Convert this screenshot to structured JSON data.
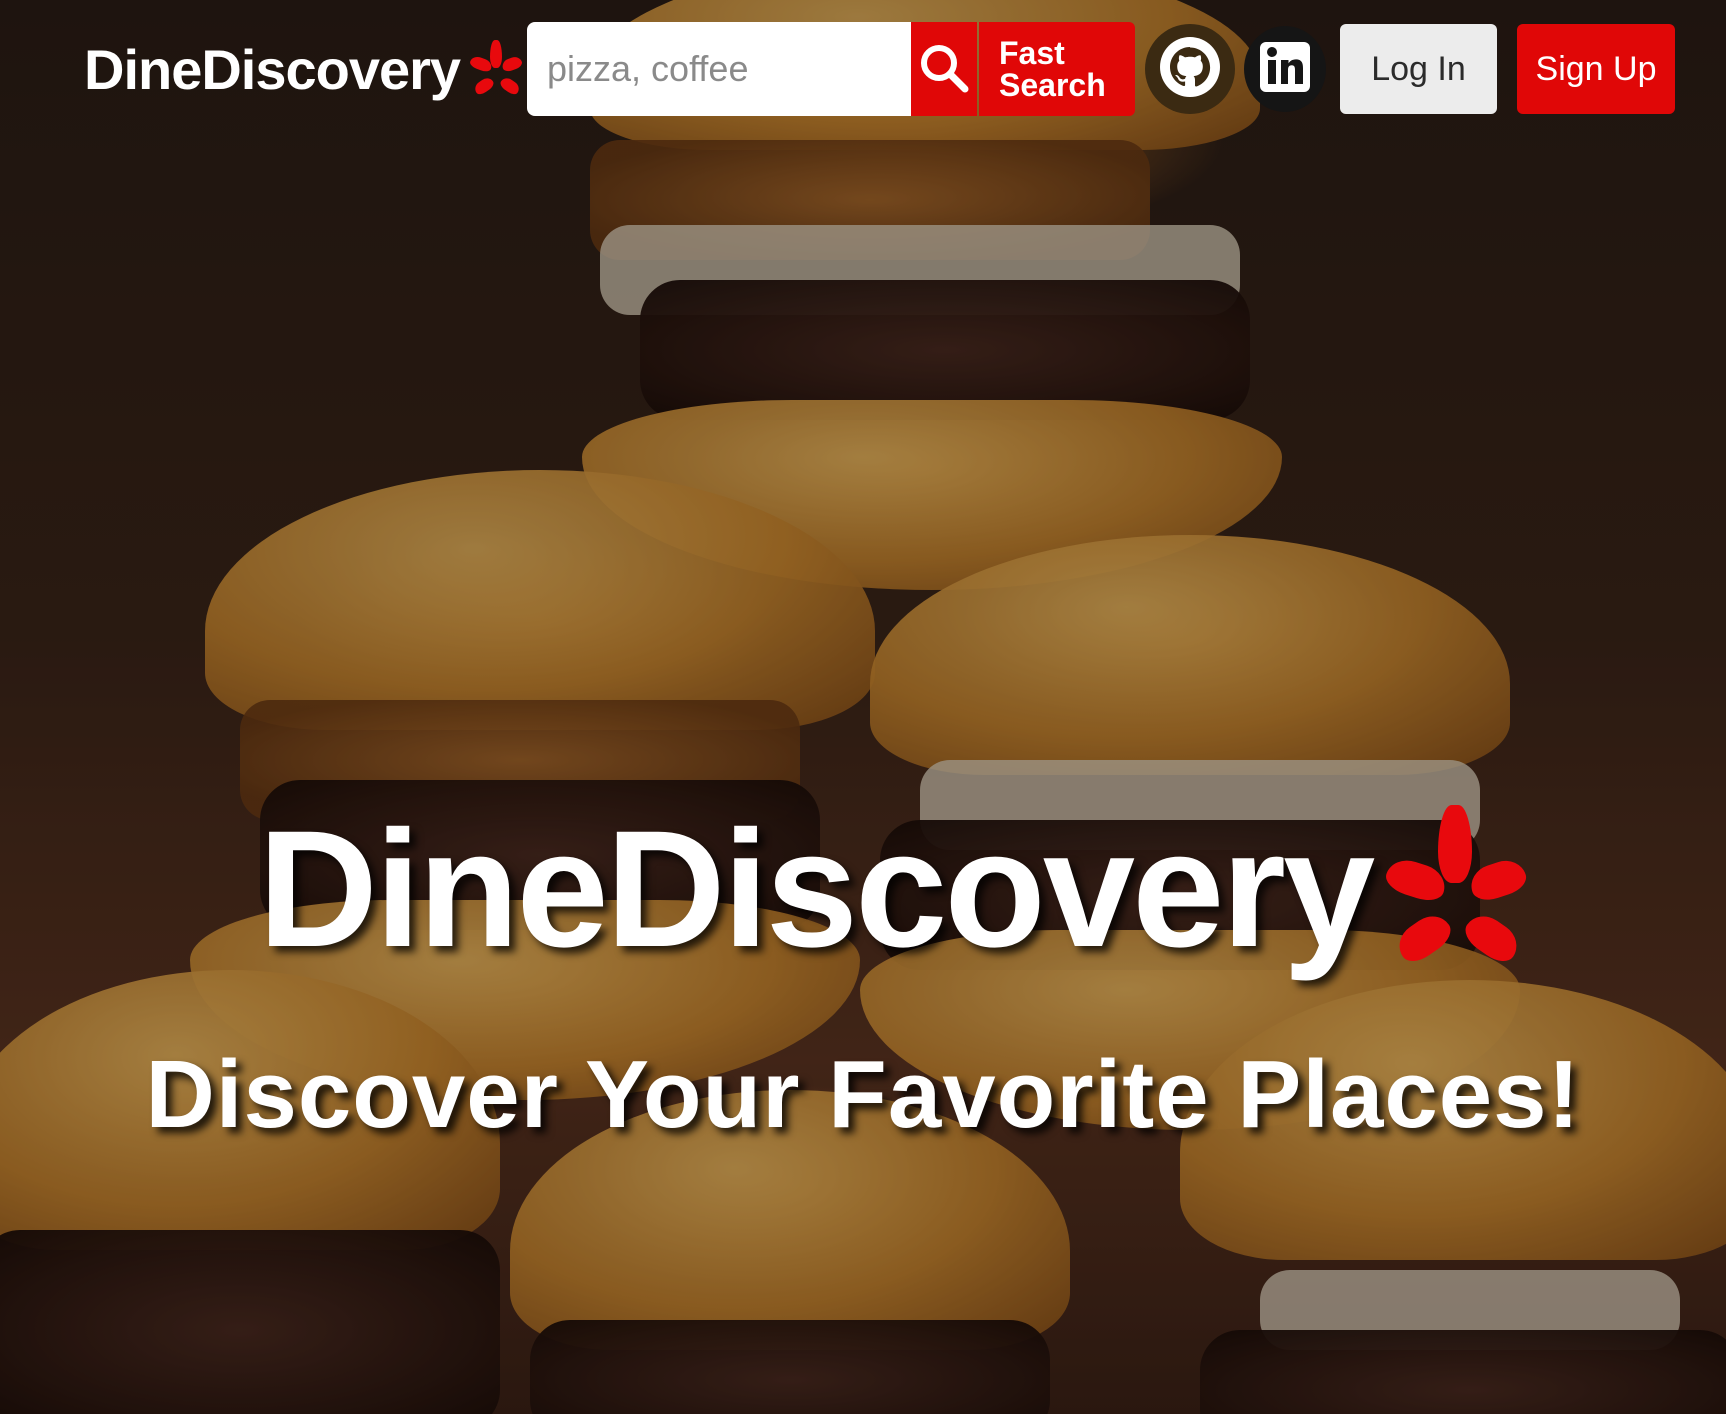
{
  "header": {
    "brand": "DineDiscovery",
    "search": {
      "placeholder": "pizza, coffee",
      "value": ""
    },
    "search_icon": "search-icon",
    "fast_search_label_line1": "Fast",
    "fast_search_label_line2": "Search",
    "social": [
      {
        "name": "GitHub",
        "icon": "github-icon"
      },
      {
        "name": "LinkedIn",
        "icon": "linkedin-icon"
      }
    ],
    "login_label": "Log In",
    "signup_label": "Sign Up"
  },
  "hero": {
    "title": "DineDiscovery",
    "subtitle": "Discover Your Favorite Places!",
    "background": "burgers-photo"
  },
  "colors": {
    "accent": "#e00707",
    "login_bg": "#ececec",
    "text_light": "#ffffff"
  }
}
